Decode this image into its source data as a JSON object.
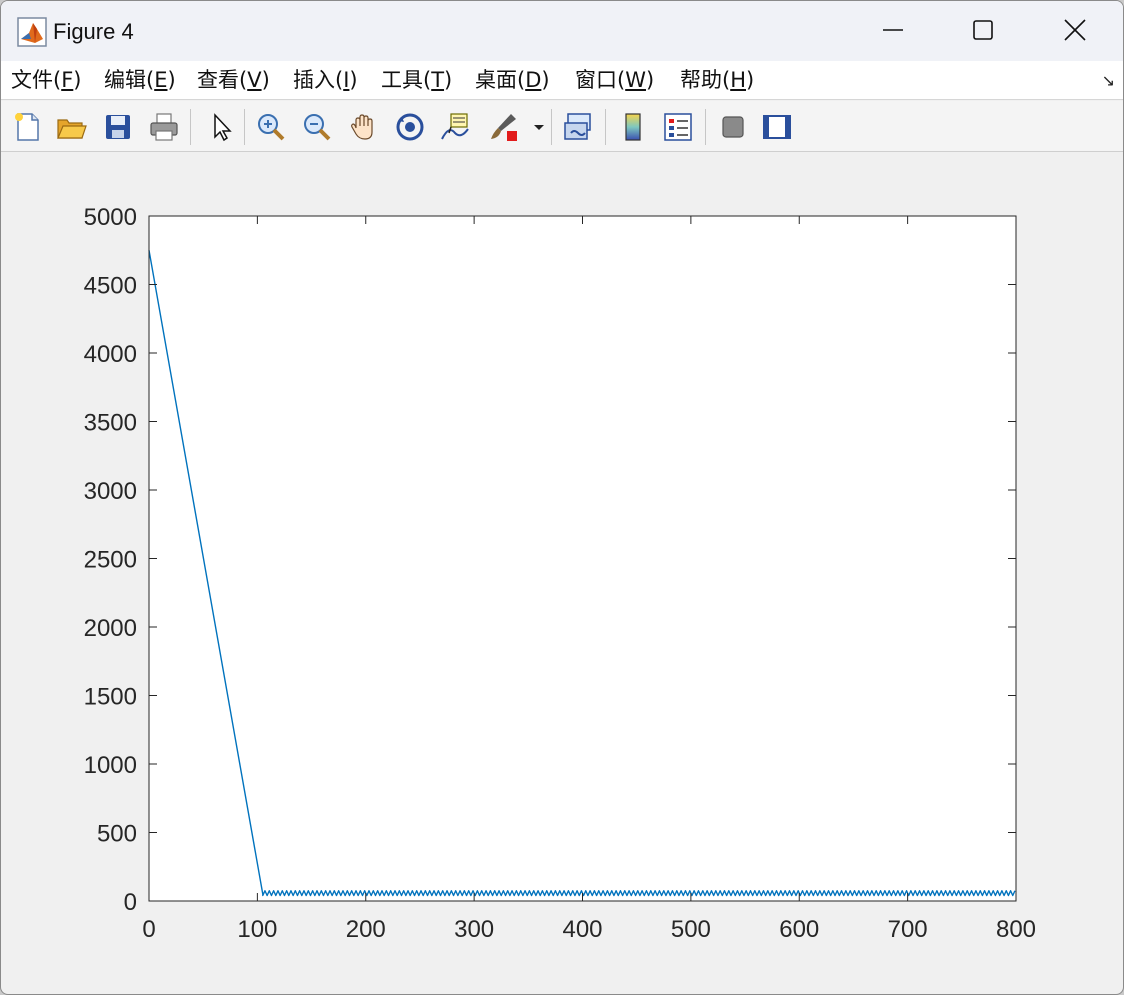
{
  "window": {
    "title": "Figure 4"
  },
  "menu": {
    "items": [
      {
        "key": "file",
        "label": "文件(",
        "mnemonic": "F",
        "tail": ")"
      },
      {
        "key": "edit",
        "label": "编辑(",
        "mnemonic": "E",
        "tail": ")"
      },
      {
        "key": "view",
        "label": "查看(",
        "mnemonic": "V",
        "tail": ")"
      },
      {
        "key": "insert",
        "label": "插入(",
        "mnemonic": "I",
        "tail": ")"
      },
      {
        "key": "tools",
        "label": "工具(",
        "mnemonic": "T",
        "tail": ")"
      },
      {
        "key": "desktop",
        "label": "桌面(",
        "mnemonic": "D",
        "tail": ")"
      },
      {
        "key": "window",
        "label": "窗口(",
        "mnemonic": "W",
        "tail": ")"
      },
      {
        "key": "help",
        "label": "帮助(",
        "mnemonic": "H",
        "tail": ")"
      }
    ],
    "overflow_icon": "dock-arrow-icon"
  },
  "toolbar": {
    "icons": [
      "new-figure-icon",
      "open-folder-icon",
      "save-icon",
      "print-icon",
      "pointer-icon",
      "zoom-in-icon",
      "zoom-out-icon",
      "pan-hand-icon",
      "rotate-3d-icon",
      "data-cursor-icon",
      "brush-icon",
      "brush-dropdown-icon",
      "link-plot-icon",
      "colorbar-icon",
      "legend-icon",
      "hide-plot-tools-icon",
      "show-plot-tools-icon"
    ]
  },
  "colors": {
    "line": "#0072bd",
    "axes": "#262626",
    "background": "#f0f0f0"
  },
  "chart_data": {
    "type": "line",
    "title": "",
    "xlabel": "",
    "ylabel": "",
    "xlim": [
      0,
      800
    ],
    "ylim": [
      0,
      5000
    ],
    "xticks": [
      0,
      100,
      200,
      300,
      400,
      500,
      600,
      700,
      800
    ],
    "yticks": [
      0,
      500,
      1000,
      1500,
      2000,
      2500,
      3000,
      3500,
      4000,
      4500,
      5000
    ],
    "grid": false,
    "series": [
      {
        "color": "#0072bd",
        "description_points": [
          [
            0,
            4750
          ],
          [
            105,
            50
          ]
        ],
        "oscillation": {
          "x_start": 105,
          "x_end": 800,
          "period": 4,
          "low": 40,
          "high": 75
        }
      }
    ]
  }
}
